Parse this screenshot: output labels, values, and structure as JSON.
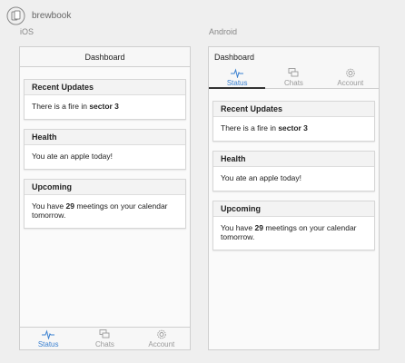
{
  "app": {
    "name": "brewbook"
  },
  "ios": {
    "platform_label": "iOS",
    "title": "Dashboard",
    "cards": [
      {
        "title": "Recent Updates",
        "text_before": "There is a fire in ",
        "text_bold": "sector 3",
        "text_after": ""
      },
      {
        "title": "Health",
        "text_before": "You ate an apple today!",
        "text_bold": "",
        "text_after": ""
      },
      {
        "title": "Upcoming",
        "text_before": "You have ",
        "text_bold": "29",
        "text_after": " meetings on your calendar tomorrow."
      }
    ],
    "tabs": [
      {
        "label": "Status",
        "icon": "pulse-icon",
        "active": true
      },
      {
        "label": "Chats",
        "icon": "chat-icon",
        "active": false
      },
      {
        "label": "Account",
        "icon": "gear-icon",
        "active": false
      }
    ]
  },
  "android": {
    "platform_label": "Android",
    "title": "Dashboard",
    "cards": [
      {
        "title": "Recent Updates",
        "text_before": "There is a fire in ",
        "text_bold": "sector 3",
        "text_after": ""
      },
      {
        "title": "Health",
        "text_before": "You ate an apple today!",
        "text_bold": "",
        "text_after": ""
      },
      {
        "title": "Upcoming",
        "text_before": "You have ",
        "text_bold": "29",
        "text_after": " meetings on your calendar tomorrow."
      }
    ],
    "tabs": [
      {
        "label": "Status",
        "icon": "pulse-icon",
        "active": true
      },
      {
        "label": "Chats",
        "icon": "chat-icon",
        "active": false
      },
      {
        "label": "Account",
        "icon": "gear-icon",
        "active": false
      }
    ]
  },
  "colors": {
    "accent": "#3a80d0",
    "inactive": "#999999",
    "background": "#efefef"
  }
}
